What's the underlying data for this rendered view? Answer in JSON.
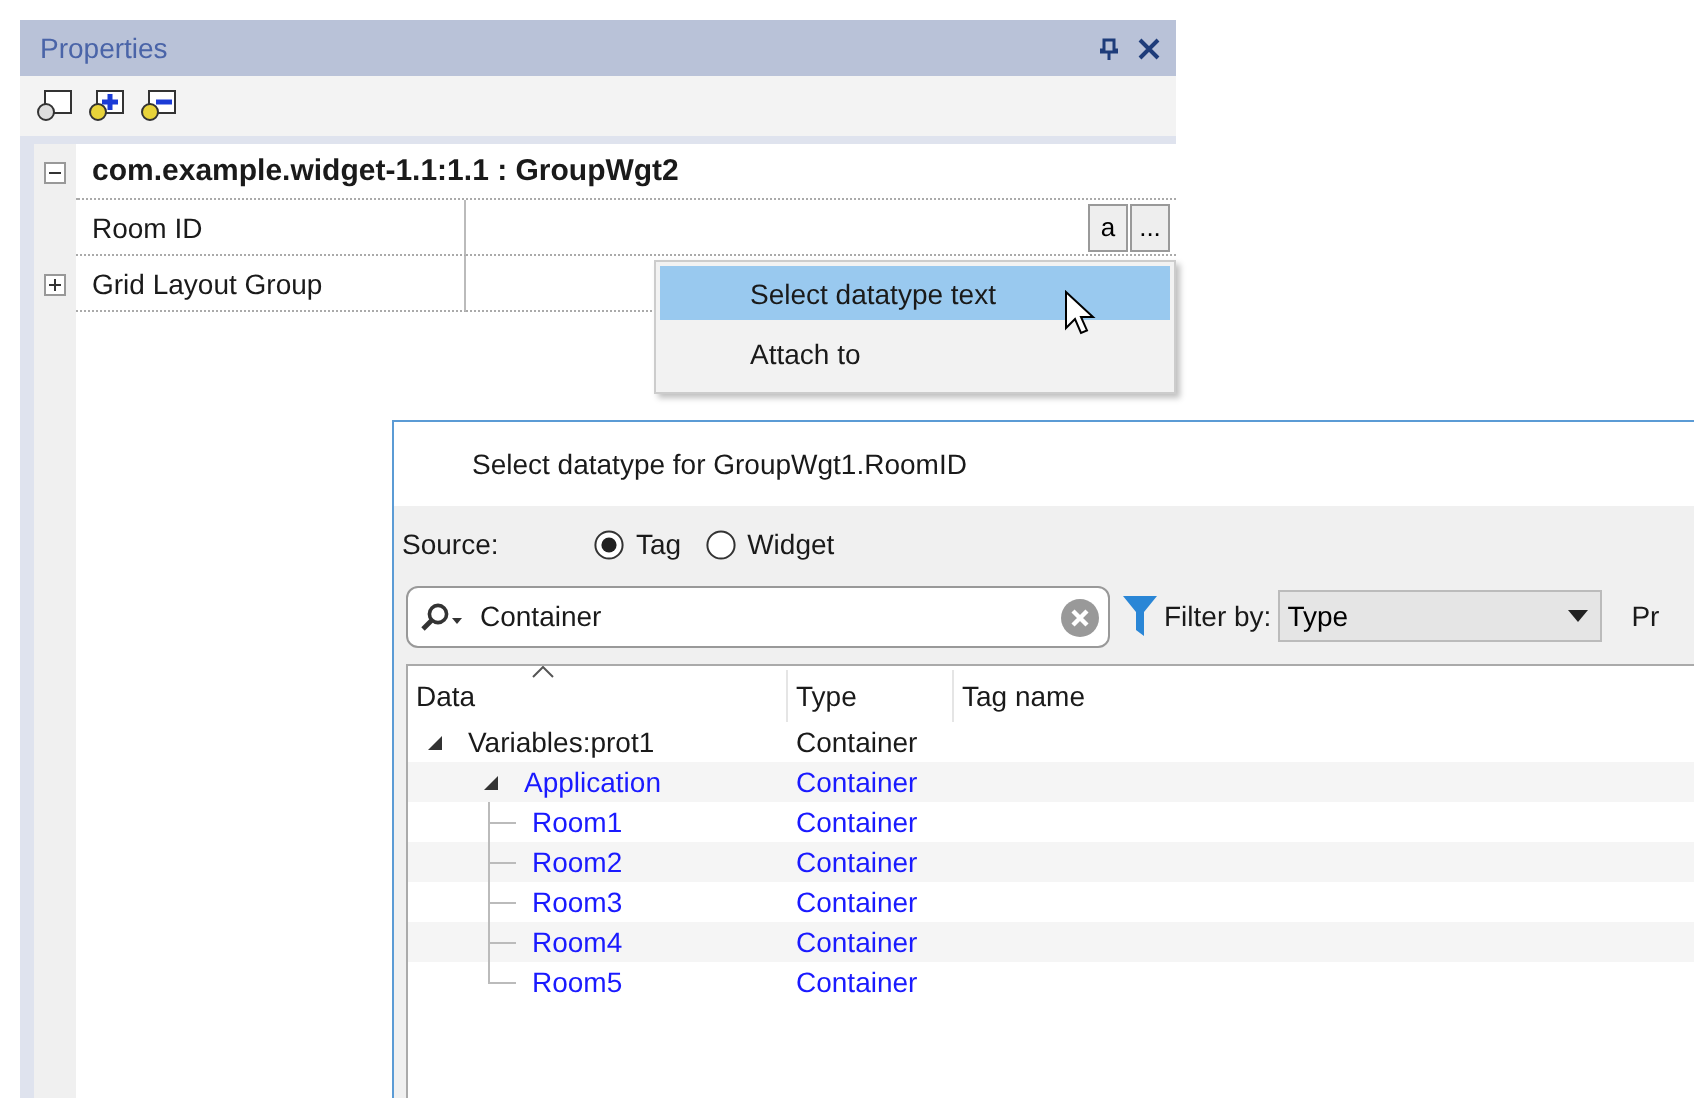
{
  "properties_panel": {
    "title": "Properties",
    "rows": [
      {
        "kind": "category",
        "label": "com.example.widget-1.1:1.1 : GroupWgt2",
        "expanded": true
      },
      {
        "kind": "property",
        "label": "Room ID",
        "buttons": [
          "a",
          "..."
        ]
      },
      {
        "kind": "group",
        "label": "Grid Layout Group",
        "expanded": false
      }
    ]
  },
  "context_menu": {
    "items": [
      {
        "label": "Select datatype text",
        "selected": true
      },
      {
        "label": "Attach to",
        "selected": false
      }
    ]
  },
  "dialog": {
    "title": "Select datatype for GroupWgt1.RoomID",
    "source": {
      "label": "Source:",
      "options": [
        {
          "label": "Tag",
          "selected": true
        },
        {
          "label": "Widget",
          "selected": false
        }
      ]
    },
    "search": {
      "value": "Container"
    },
    "filter": {
      "label": "Filter by:",
      "value": "Type"
    },
    "cut_label": "Pr",
    "columns": [
      "Data",
      "Type",
      "Tag name"
    ],
    "tree": [
      {
        "name": "Variables:prot1",
        "type": "Container",
        "matched": false,
        "expanded": true,
        "children": [
          {
            "name": "Application",
            "type": "Container",
            "matched": true,
            "expanded": true,
            "children": [
              {
                "name": "Room1",
                "type": "Container",
                "matched": true
              },
              {
                "name": "Room2",
                "type": "Container",
                "matched": true
              },
              {
                "name": "Room3",
                "type": "Container",
                "matched": true
              },
              {
                "name": "Room4",
                "type": "Container",
                "matched": true
              },
              {
                "name": "Room5",
                "type": "Container",
                "matched": true
              }
            ]
          }
        ]
      }
    ]
  }
}
